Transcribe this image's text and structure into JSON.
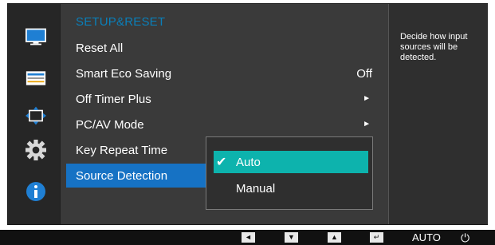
{
  "menu": {
    "title": "SETUP&RESET",
    "items": [
      {
        "label": "Reset All",
        "value": "",
        "arrow": false
      },
      {
        "label": "Smart Eco Saving",
        "value": "Off",
        "arrow": false
      },
      {
        "label": "Off Timer Plus",
        "value": "",
        "arrow": true
      },
      {
        "label": "PC/AV Mode",
        "value": "",
        "arrow": true
      },
      {
        "label": "Key Repeat Time",
        "value": "",
        "arrow": false
      },
      {
        "label": "Source Detection",
        "value": "",
        "arrow": false,
        "selected": true
      }
    ],
    "arrow_glyph": "►"
  },
  "submenu": {
    "options": [
      {
        "label": "Auto",
        "selected": true,
        "check": "✔"
      },
      {
        "label": "Manual",
        "selected": false,
        "check": ""
      }
    ]
  },
  "help": {
    "text": "Decide how input sources will be detected."
  },
  "sidebar": {
    "icons": [
      "picture-icon",
      "onscreen-display-icon",
      "position-icon",
      "setup-gear-icon",
      "information-icon"
    ]
  },
  "bottom_bar": {
    "left_glyph": "◄",
    "down_glyph": "▼",
    "up_glyph": "▲",
    "enter_glyph": "↵",
    "auto_label": "AUTO",
    "power_glyph": "⏻"
  },
  "colors": {
    "title": "#0a7fb9",
    "selected_item": "#1672c4",
    "submenu_active": "#0db3ad"
  }
}
